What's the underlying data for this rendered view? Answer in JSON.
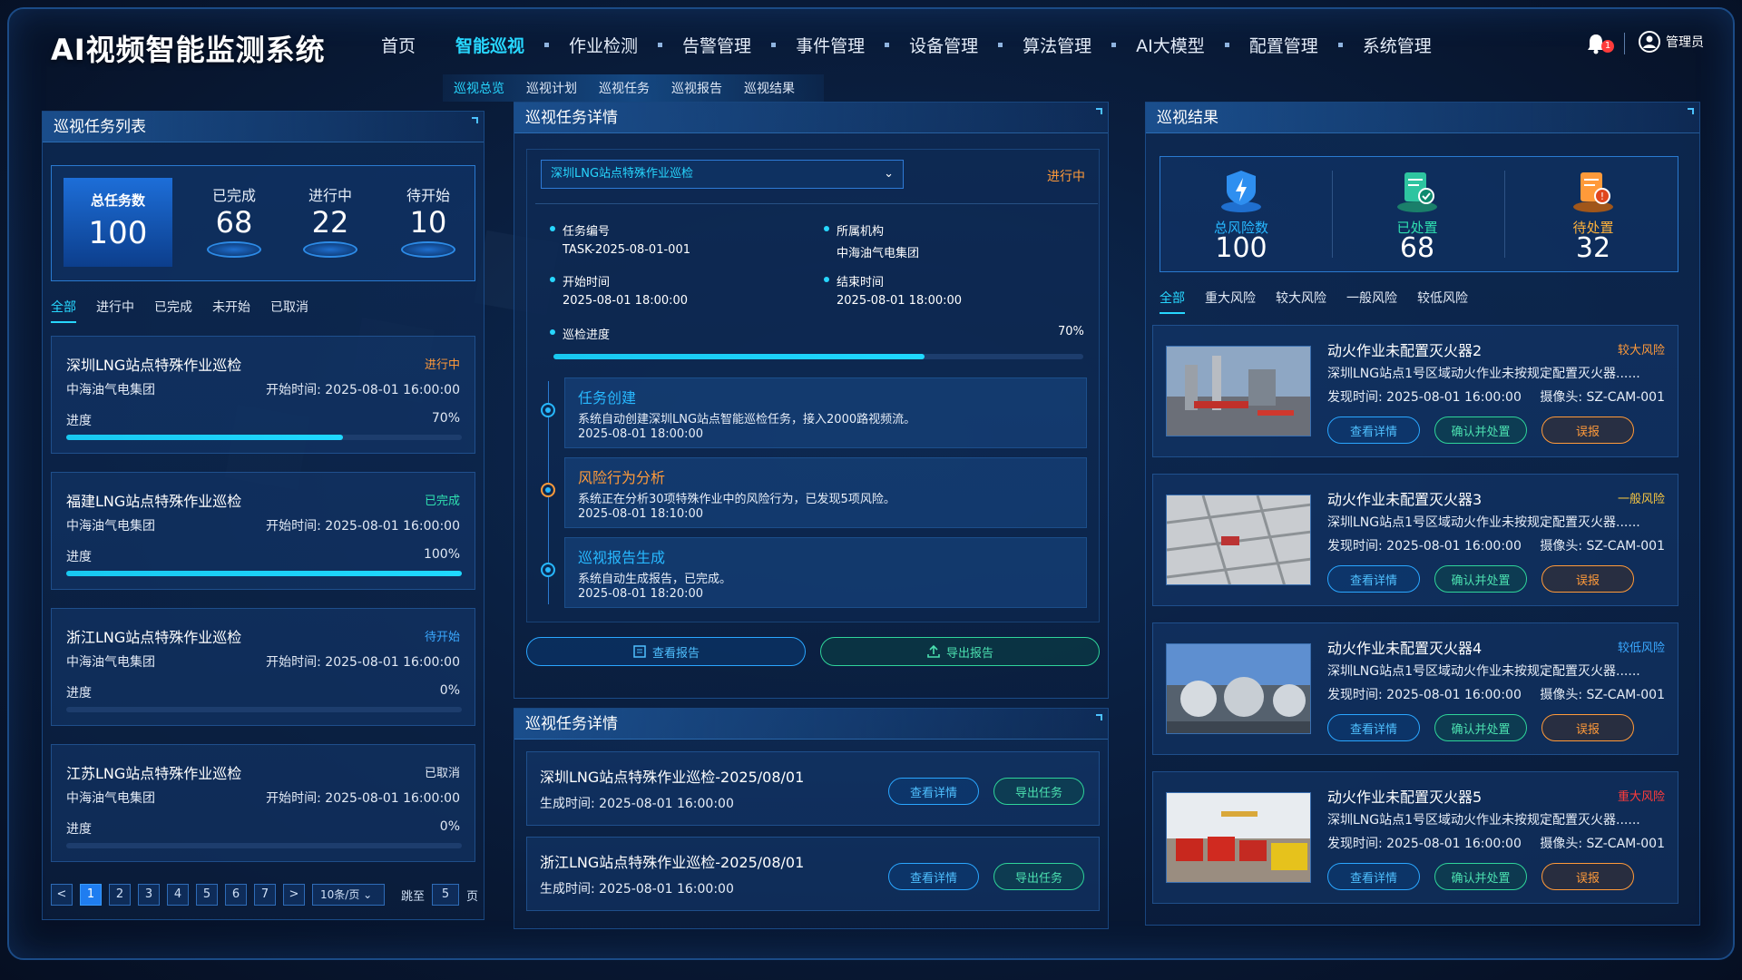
{
  "app_title": "AI视频智能监测系统",
  "nav": [
    "首页",
    "智能巡视",
    "作业检测",
    "告警管理",
    "事件管理",
    "设备管理",
    "算法管理",
    "AI大模型",
    "配置管理",
    "系统管理"
  ],
  "nav_active": "智能巡视",
  "subnav": [
    "巡视总览",
    "巡视计划",
    "巡视任务",
    "巡视报告",
    "巡视结果"
  ],
  "notifications": "1",
  "user": "管理员",
  "left": {
    "title": "巡视任务列表",
    "stats": {
      "total_label": "总任务数",
      "total": "100",
      "done_label": "已完成",
      "done": "68",
      "running_label": "进行中",
      "running": "22",
      "pending_label": "待开始",
      "pending": "10"
    },
    "tabs": [
      "全部",
      "进行中",
      "已完成",
      "未开始",
      "已取消"
    ],
    "tasks": [
      {
        "title": "深圳LNG站点特殊作业巡检",
        "status": "进行中",
        "org": "中海油气电集团",
        "start": "开始时间:  2025-08-01 16:00:00",
        "progress_label": "进度",
        "pct": "70%",
        "value": 0.7
      },
      {
        "title": "福建LNG站点特殊作业巡检",
        "status": "已完成",
        "org": "中海油气电集团",
        "start": "开始时间:  2025-08-01 16:00:00",
        "progress_label": "进度",
        "pct": "100%",
        "value": 1.0
      },
      {
        "title": "浙江LNG站点特殊作业巡检",
        "status": "待开始",
        "org": "中海油气电集团",
        "start": "开始时间:  2025-08-01 16:00:00",
        "progress_label": "进度",
        "pct": "0%",
        "value": 0
      },
      {
        "title": "江苏LNG站点特殊作业巡检",
        "status": "已取消",
        "org": "中海油气电集团",
        "start": "开始时间:  2025-08-01 16:00:00",
        "progress_label": "进度",
        "pct": "0%",
        "value": 0
      }
    ],
    "pagination": {
      "pages": [
        "1",
        "2",
        "3",
        "4",
        "5",
        "6",
        "7"
      ],
      "active": "1",
      "per_page": "10条/页",
      "jump_label": "跳至",
      "jump_value": "5",
      "page_suffix": "页",
      "prev": "<",
      "next": ">"
    }
  },
  "center": {
    "title": "巡视任务详情",
    "selected_task": "深圳LNG站点特殊作业巡检",
    "status": "进行中",
    "info": {
      "id_label": "任务编号",
      "id": "TASK-2025-08-01-001",
      "org_label": "所属机构",
      "org": "中海油气电集团",
      "start_label": "开始时间",
      "start": "2025-08-01 18:00:00",
      "end_label": "结束时间",
      "end": "2025-08-01 18:00:00",
      "progress_label": "巡检进度",
      "progress": "70%",
      "progress_value": 0.7
    },
    "timeline": [
      {
        "title": "任务创建",
        "desc": "系统自动创建深圳LNG站点智能巡检任务，接入2000路视频流。",
        "time": "2025-08-01 18:00:00",
        "color": "#27b8ff"
      },
      {
        "title": "风险行为分析",
        "desc": "系统正在分析30项特殊作业中的风险行为，已发现5项风险。",
        "time": "2025-08-01 18:10:00",
        "color": "#ff9a3a"
      },
      {
        "title": "巡视报告生成",
        "desc": "系统自动生成报告，已完成。",
        "time": "2025-08-01 18:20:00",
        "color": "#27b8ff"
      }
    ],
    "view_report": "查看报告",
    "export_report": "导出报告",
    "reports_title": "巡视任务详情",
    "reports": [
      {
        "title": "深圳LNG站点特殊作业巡检-2025/08/01",
        "time": "生成时间:  2025-08-01 16:00:00",
        "view": "查看详情",
        "export": "导出任务"
      },
      {
        "title": "浙江LNG站点特殊作业巡检-2025/08/01",
        "time": "生成时间:  2025-08-01 16:00:00",
        "view": "查看详情",
        "export": "导出任务"
      }
    ]
  },
  "right": {
    "title": "巡视结果",
    "stats": {
      "total_label": "总风险数",
      "total": "100",
      "done_label": "已处置",
      "done": "68",
      "pending_label": "待处置",
      "pending": "32"
    },
    "tabs": [
      "全部",
      "重大风险",
      "较大风险",
      "一般风险",
      "较低风险"
    ],
    "results": [
      {
        "title": "动火作业未配置灭火器2",
        "risk": "较大风险",
        "risk_color": "#ff9a3a",
        "desc": "深圳LNG站点1号区域动火作业未按规定配置灭火器......",
        "time": "发现时间:  2025-08-01 16:00:00",
        "cam": "摄像头: SZ-CAM-001",
        "view": "查看详情",
        "confirm": "确认并处置",
        "false": "误报"
      },
      {
        "title": "动火作业未配置灭火器3",
        "risk": "一般风险",
        "risk_color": "#f5c542",
        "desc": "深圳LNG站点1号区域动火作业未按规定配置灭火器......",
        "time": "发现时间:  2025-08-01 16:00:00",
        "cam": "摄像头: SZ-CAM-001",
        "view": "查看详情",
        "confirm": "确认并处置",
        "false": "误报"
      },
      {
        "title": "动火作业未配置灭火器4",
        "risk": "较低风险",
        "risk_color": "#3aa8ff",
        "desc": "深圳LNG站点1号区域动火作业未按规定配置灭火器......",
        "time": "发现时间:  2025-08-01 16:00:00",
        "cam": "摄像头: SZ-CAM-001",
        "view": "查看详情",
        "confirm": "确认并处置",
        "false": "误报"
      },
      {
        "title": "动火作业未配置灭火器5",
        "risk": "重大风险",
        "risk_color": "#ff3b3b",
        "desc": "深圳LNG站点1号区域动火作业未按规定配置灭火器......",
        "time": "发现时间:  2025-08-01 16:00:00",
        "cam": "摄像头: SZ-CAM-001",
        "view": "查看详情",
        "confirm": "确认并处置",
        "false": "误报"
      }
    ]
  }
}
